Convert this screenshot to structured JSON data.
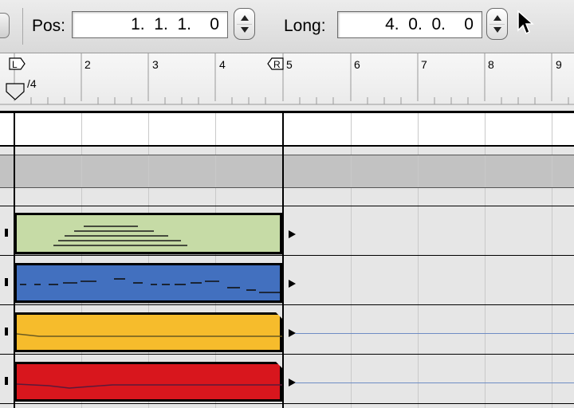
{
  "toolbar": {
    "pos_label": "Pos:",
    "pos_value": "1.  1.  1.    0",
    "long_label": "Long:",
    "long_value": "4.  0.  0.    0"
  },
  "ruler": {
    "bars": [
      "2",
      "3",
      "4",
      "5",
      "6",
      "7",
      "8",
      "9"
    ],
    "left_locator": "L",
    "right_locator": "R",
    "time_signature": "/4"
  },
  "tracks": [
    {
      "name": "green-clip",
      "color": "#c6dba6",
      "content": "notes"
    },
    {
      "name": "blue-clip",
      "color": "#4270bf",
      "content": "notes"
    },
    {
      "name": "yellow-clip",
      "color": "#f6bc2c",
      "content": "automation"
    },
    {
      "name": "red-clip",
      "color": "#d8161d",
      "content": "automation"
    }
  ],
  "icons": [
    "up-arrow-icon",
    "down-arrow-icon",
    "pointer-cursor-icon",
    "play-arrow-icon"
  ]
}
